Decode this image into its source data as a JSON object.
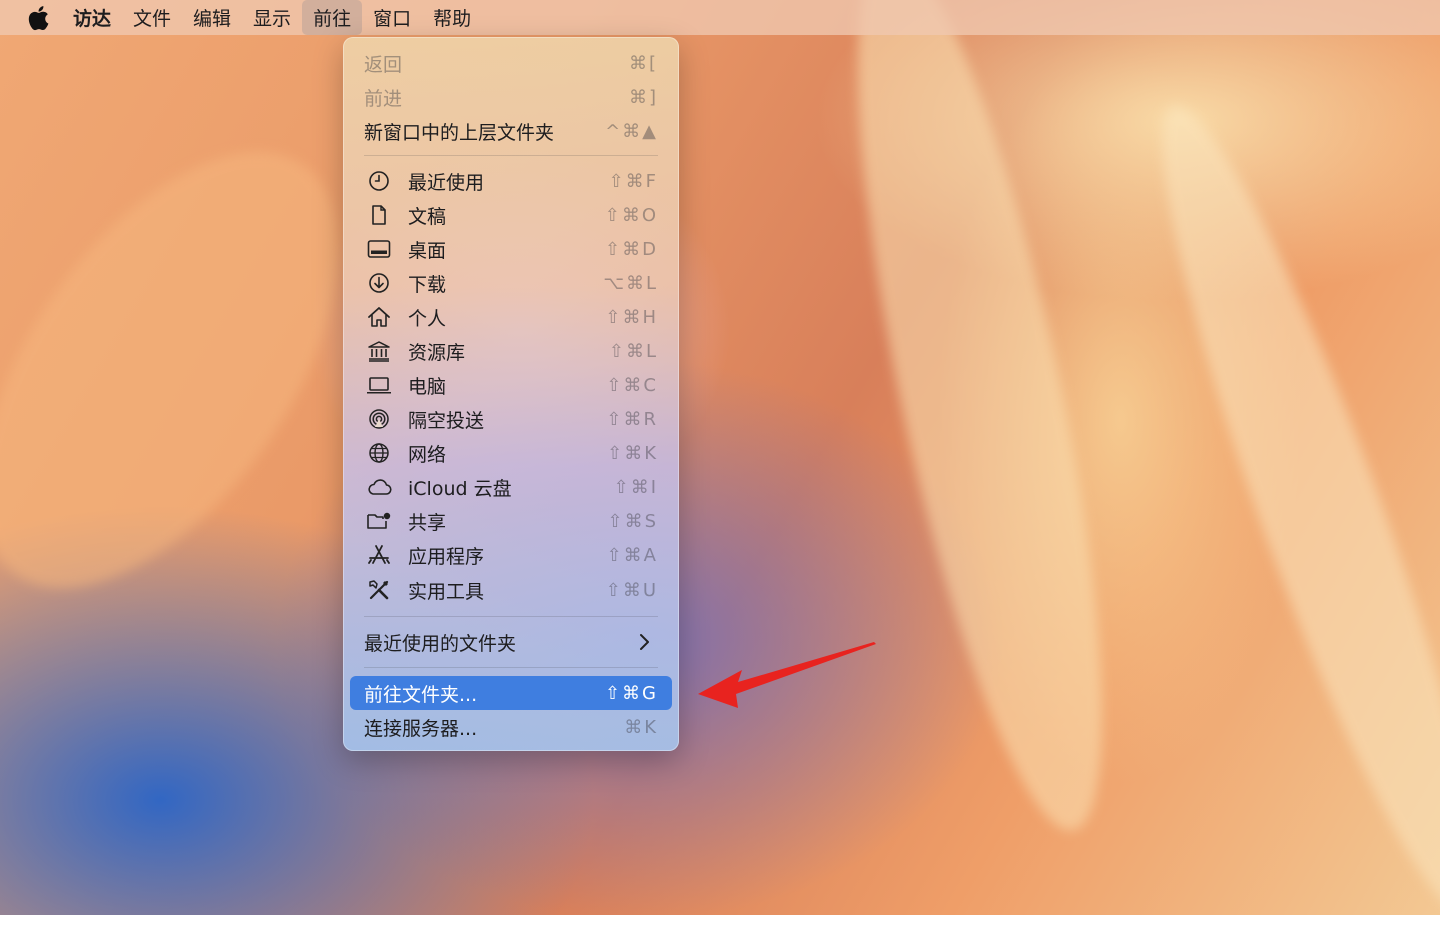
{
  "menubar": {
    "apple_icon": "apple-logo-icon",
    "items": [
      "访达",
      "文件",
      "编辑",
      "显示",
      "前往",
      "窗口",
      "帮助"
    ],
    "active": "前往"
  },
  "go_menu": {
    "group1": [
      {
        "label": "返回",
        "shortcut": "⌘[",
        "disabled": true
      },
      {
        "label": "前进",
        "shortcut": "⌘]",
        "disabled": true
      },
      {
        "label": "新窗口中的上层文件夹",
        "shortcut": "^⌘▲",
        "disabled": false
      }
    ],
    "places": [
      {
        "label": "最近使用",
        "shortcut": "⇧⌘F",
        "icon": "clock-icon"
      },
      {
        "label": "文稿",
        "shortcut": "⇧⌘O",
        "icon": "document-icon"
      },
      {
        "label": "桌面",
        "shortcut": "⇧⌘D",
        "icon": "desktop-icon"
      },
      {
        "label": "下载",
        "shortcut": "⌥⌘L",
        "icon": "download-icon"
      },
      {
        "label": "个人",
        "shortcut": "⇧⌘H",
        "icon": "home-icon"
      },
      {
        "label": "资源库",
        "shortcut": "⇧⌘L",
        "icon": "library-icon"
      },
      {
        "label": "电脑",
        "shortcut": "⇧⌘C",
        "icon": "laptop-icon"
      },
      {
        "label": "隔空投送",
        "shortcut": "⇧⌘R",
        "icon": "airdrop-icon"
      },
      {
        "label": "网络",
        "shortcut": "⇧⌘K",
        "icon": "globe-icon"
      },
      {
        "label": "iCloud 云盘",
        "shortcut": "⇧⌘I",
        "icon": "cloud-icon"
      },
      {
        "label": "共享",
        "shortcut": "⇧⌘S",
        "icon": "shared-folder-icon"
      },
      {
        "label": "应用程序",
        "shortcut": "⇧⌘A",
        "icon": "app-store-icon"
      },
      {
        "label": "实用工具",
        "shortcut": "⇧⌘U",
        "icon": "tools-icon"
      }
    ],
    "recent_folders": {
      "label": "最近使用的文件夹"
    },
    "group3": [
      {
        "label": "前往文件夹...",
        "shortcut": "⇧⌘G",
        "highlighted": true
      },
      {
        "label": "连接服务器...",
        "shortcut": "⌘K",
        "highlighted": false
      }
    ]
  },
  "annotation": {
    "icon": "red-arrow-icon",
    "color": "#e8231f"
  }
}
